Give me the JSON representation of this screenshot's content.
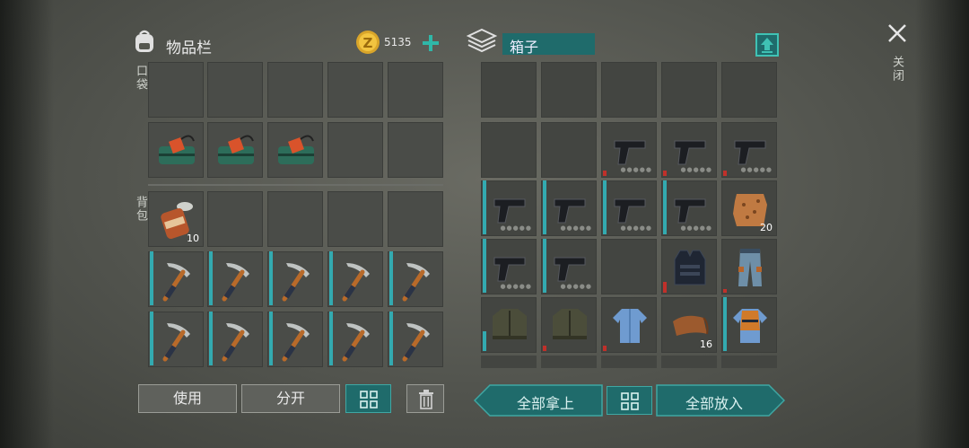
{
  "inventory": {
    "title": "物品栏",
    "pocket_label": "口袋",
    "backpack_label": "背包",
    "coins": "5135"
  },
  "box": {
    "title": "箱子"
  },
  "close_label": "关闭",
  "left_items": {
    "can_qty": "10"
  },
  "right_items": {
    "hide_qty": "20",
    "leather_qty": "16"
  },
  "buttons": {
    "use": "使用",
    "split": "分开",
    "take_all": "全部拿上",
    "put_all": "全部放入"
  },
  "colors": {
    "accent": "#1f6b6b",
    "durability_teal": "#33aab0",
    "durability_red": "#c0302a"
  }
}
